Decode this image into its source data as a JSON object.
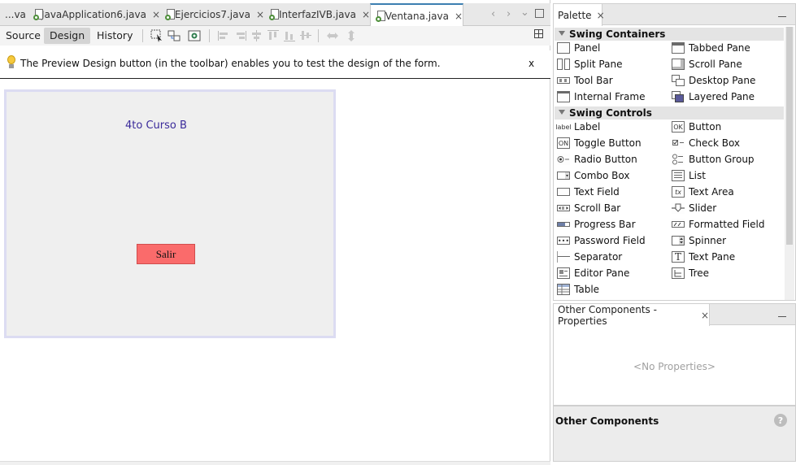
{
  "tabs": [
    {
      "label": "...va",
      "active": false,
      "closable": false
    },
    {
      "label": "JavaApplication6.java",
      "active": false,
      "closable": true
    },
    {
      "label": "Ejercicios7.java",
      "active": false,
      "closable": true
    },
    {
      "label": "InterfazIVB.java",
      "active": false,
      "closable": true
    },
    {
      "label": "Ventana.java",
      "active": true,
      "closable": true
    }
  ],
  "close_glyph": "×",
  "toolbar": {
    "source": "Source",
    "design": "Design",
    "history": "History"
  },
  "info": {
    "message": "The Preview Design button (in the toolbar) enables you to test the design of the form.",
    "close": "x"
  },
  "form": {
    "label_text": "4to Curso B",
    "button_text": "Salir",
    "button_color": "#fa6b6b"
  },
  "palette": {
    "title": "Palette",
    "sections": [
      {
        "title": "Swing Containers",
        "items": [
          {
            "label": "Panel",
            "icon": "panel-icon"
          },
          {
            "label": "Tabbed Pane",
            "icon": "tabbed-pane-icon"
          },
          {
            "label": "Split Pane",
            "icon": "split-pane-icon"
          },
          {
            "label": "Scroll Pane",
            "icon": "scroll-pane-icon"
          },
          {
            "label": "Tool Bar",
            "icon": "tool-bar-icon"
          },
          {
            "label": "Desktop Pane",
            "icon": "desktop-pane-icon"
          },
          {
            "label": "Internal Frame",
            "icon": "internal-frame-icon"
          },
          {
            "label": "Layered Pane",
            "icon": "layered-pane-icon"
          }
        ]
      },
      {
        "title": "Swing Controls",
        "items": [
          {
            "label": "Label",
            "icon": "label-icon",
            "icon_text": "label"
          },
          {
            "label": "Button",
            "icon": "button-icon",
            "icon_text": "OK"
          },
          {
            "label": "Toggle Button",
            "icon": "toggle-button-icon",
            "icon_text": "ON"
          },
          {
            "label": "Check Box",
            "icon": "check-box-icon"
          },
          {
            "label": "Radio Button",
            "icon": "radio-button-icon"
          },
          {
            "label": "Button Group",
            "icon": "button-group-icon"
          },
          {
            "label": "Combo Box",
            "icon": "combo-box-icon"
          },
          {
            "label": "List",
            "icon": "list-icon"
          },
          {
            "label": "Text Field",
            "icon": "text-field-icon"
          },
          {
            "label": "Text Area",
            "icon": "text-area-icon",
            "icon_text": "tx"
          },
          {
            "label": "Scroll Bar",
            "icon": "scroll-bar-icon"
          },
          {
            "label": "Slider",
            "icon": "slider-icon"
          },
          {
            "label": "Progress Bar",
            "icon": "progress-bar-icon"
          },
          {
            "label": "Formatted Field",
            "icon": "formatted-field-icon"
          },
          {
            "label": "Password Field",
            "icon": "password-field-icon",
            "icon_text": "•••"
          },
          {
            "label": "Spinner",
            "icon": "spinner-icon"
          },
          {
            "label": "Separator",
            "icon": "separator-icon"
          },
          {
            "label": "Text Pane",
            "icon": "text-pane-icon",
            "icon_text": "T"
          },
          {
            "label": "Editor Pane",
            "icon": "editor-pane-icon"
          },
          {
            "label": "Tree",
            "icon": "tree-icon"
          },
          {
            "label": "Table",
            "icon": "table-icon"
          }
        ]
      }
    ]
  },
  "properties": {
    "tab_title": "Other Components - Properties",
    "empty_text": "<No Properties>"
  },
  "other_components": {
    "title": "Other Components",
    "help": "?"
  }
}
